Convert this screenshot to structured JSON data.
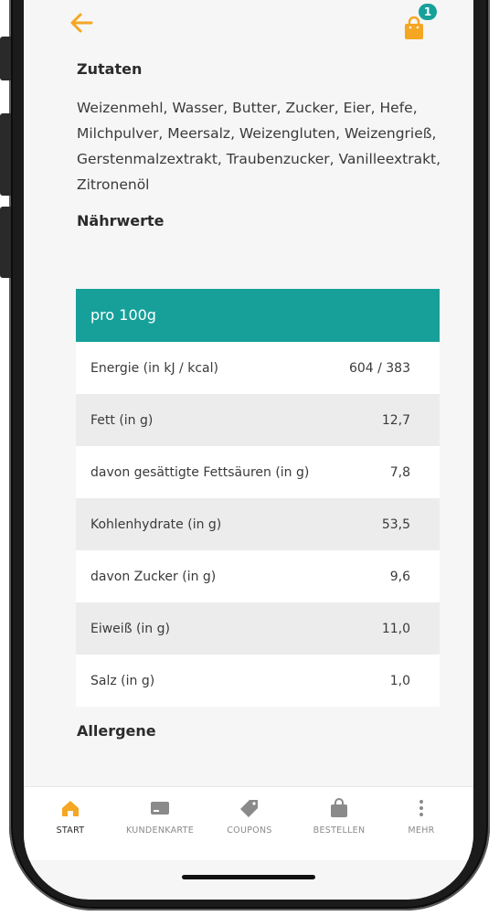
{
  "colors": {
    "accent_orange": "#f5a623",
    "accent_teal": "#17a09a",
    "text_dark": "#2b2b2b"
  },
  "header": {
    "back_icon": "arrow-left-icon",
    "cart_icon": "shopping-bag-icon",
    "cart_count": "1"
  },
  "ingredients": {
    "title": "Zutaten",
    "text": "Weizenmehl, Wasser, Butter, Zucker, Eier, Hefe, Milchpulver, Meersalz, Weizengluten, Weizengrieß, Gerstenmalzextrakt, Traubenzucker, Vanilleextrakt, Zitronenöl"
  },
  "nutrition": {
    "title": "Nährwerte",
    "header": "pro 100g",
    "rows": [
      {
        "label": "Energie (in kJ / kcal)",
        "value": "604 / 383"
      },
      {
        "label": "Fett (in g)",
        "value": "12,7"
      },
      {
        "label": "davon gesättigte Fettsäuren (in g)",
        "value": "7,8"
      },
      {
        "label": "Kohlenhydrate (in g)",
        "value": "53,5"
      },
      {
        "label": "davon Zucker (in g)",
        "value": "9,6"
      },
      {
        "label": "Eiweiß (in g)",
        "value": "11,0"
      },
      {
        "label": "Salz (in g)",
        "value": "1,0"
      }
    ]
  },
  "allergens": {
    "title": "Allergene"
  },
  "nav": {
    "items": [
      {
        "label": "START",
        "icon": "home-icon",
        "active": true
      },
      {
        "label": "KUNDENKARTE",
        "icon": "card-icon",
        "active": false
      },
      {
        "label": "COUPONS",
        "icon": "tag-icon",
        "active": false
      },
      {
        "label": "BESTELLEN",
        "icon": "shopping-bag-icon",
        "active": false
      },
      {
        "label": "MEHR",
        "icon": "more-vertical-icon",
        "active": false
      }
    ]
  }
}
